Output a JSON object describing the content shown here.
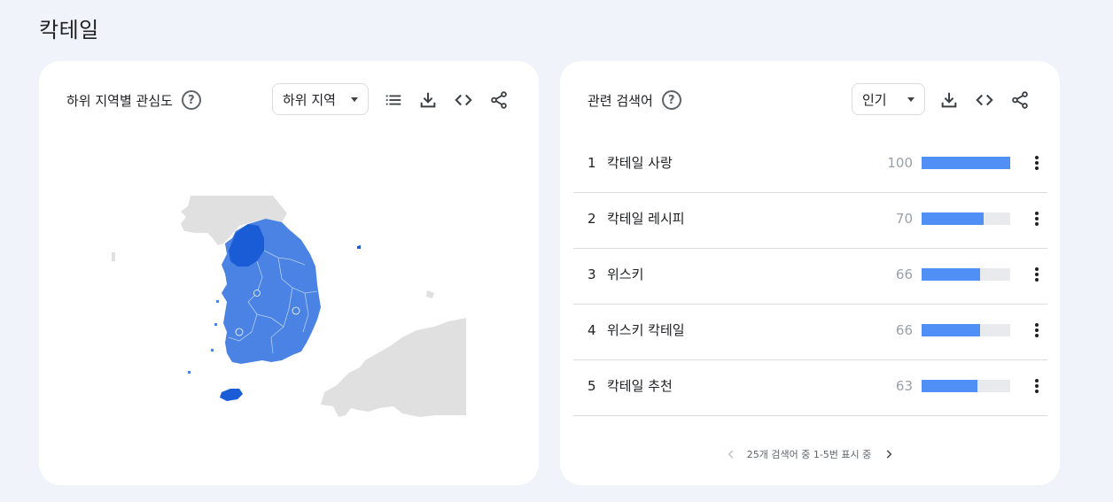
{
  "page": {
    "title": "칵테일"
  },
  "colors": {
    "accent": "#4f8ff6",
    "map_high": "#1a5cd6",
    "map_mid": "#4a83e3",
    "map_land": "#e0e0e0"
  },
  "left_card": {
    "title": "하위 지역별 관심도",
    "help_glyph": "?",
    "dropdown": {
      "selected": "하위 지역"
    },
    "tools": [
      "list-icon",
      "download-icon",
      "embed-icon",
      "share-icon"
    ]
  },
  "right_card": {
    "title": "관련 검색어",
    "help_glyph": "?",
    "dropdown": {
      "selected": "인기"
    },
    "tools": [
      "download-icon",
      "embed-icon",
      "share-icon"
    ],
    "rows": [
      {
        "rank": "1",
        "term": "칵테일 사랑",
        "value": "100",
        "level": 1.0
      },
      {
        "rank": "2",
        "term": "칵테일 레시피",
        "value": "70",
        "level": 0.7
      },
      {
        "rank": "3",
        "term": "위스키",
        "value": "66",
        "level": 0.66
      },
      {
        "rank": "4",
        "term": "위스키 칵테일",
        "value": "66",
        "level": 0.66
      },
      {
        "rank": "5",
        "term": "칵테일 추천",
        "value": "63",
        "level": 0.63
      }
    ],
    "pager": {
      "label": "25개 검색어 중 1-5번 표시 중"
    }
  }
}
